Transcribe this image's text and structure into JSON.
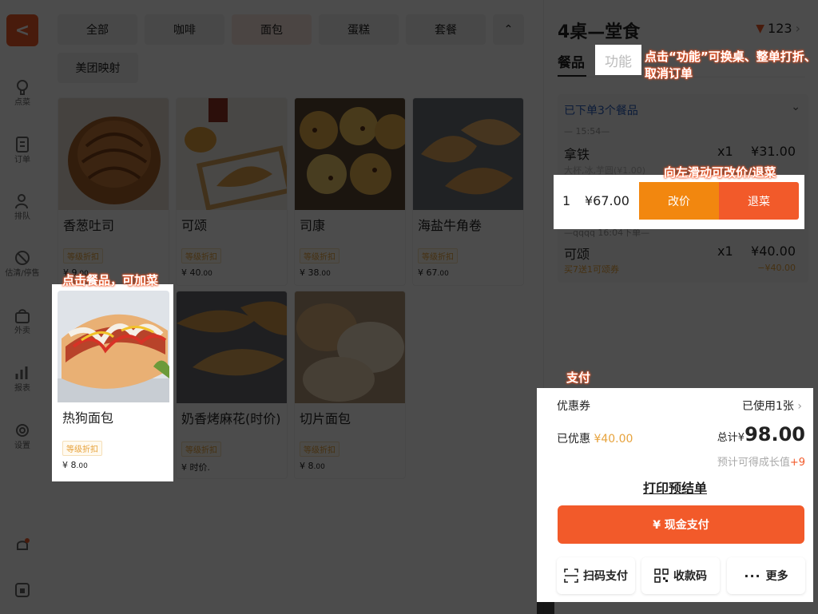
{
  "nav": {
    "back_label": "<",
    "items": [
      {
        "label": "点菜"
      },
      {
        "label": "订单"
      },
      {
        "label": "排队"
      },
      {
        "label": "估清/停售"
      },
      {
        "label": "外卖"
      },
      {
        "label": "报表"
      },
      {
        "label": "设置"
      }
    ]
  },
  "categories": [
    "全部",
    "咖啡",
    "面包",
    "蛋糕",
    "套餐",
    "美团映射"
  ],
  "active_category": "面包",
  "products": [
    {
      "name": "香葱吐司",
      "tag": "等级折扣",
      "currency": "¥",
      "price_int": "9",
      "price_dec": ".00"
    },
    {
      "name": "可颂",
      "tag": "等级折扣",
      "currency": "¥",
      "price_int": "40",
      "price_dec": ".00"
    },
    {
      "name": "司康",
      "tag": "等级折扣",
      "currency": "¥",
      "price_int": "38",
      "price_dec": ".00"
    },
    {
      "name": "海盐牛角卷",
      "tag": "等级折扣",
      "currency": "¥",
      "price_int": "67",
      "price_dec": ".00"
    },
    {
      "name": "热狗面包",
      "tag": "等级折扣",
      "currency": "¥",
      "price_int": "8",
      "price_dec": ".00"
    },
    {
      "name": "奶香烤麻花(时价)",
      "tag": "等级折扣",
      "currency": "¥",
      "price_int": "时价.",
      "price_dec": ""
    },
    {
      "name": "切片面包",
      "tag": "等级折扣",
      "currency": "¥",
      "price_int": "8",
      "price_dec": ".00"
    }
  ],
  "order": {
    "table_title": "4桌—堂食",
    "member_count": "123",
    "tab_items": "餐品",
    "tab_functions": "功能",
    "ordered_header": "已下单3个餐品",
    "batch1_time": "— 15:54—",
    "items": [
      {
        "name": "拿铁",
        "qty": "x1",
        "price": "¥31.00",
        "sub": "大杯,冰,芋圆(¥1.00)"
      },
      {
        "name": "可颂",
        "qty": "x1",
        "price": "¥40.00",
        "sub": "买7送1可颂券",
        "discount": "−¥40.00"
      }
    ],
    "swipe_row": {
      "qty": "1",
      "price": "¥67.00",
      "edit_price": "改价",
      "return_item": "退菜"
    },
    "batch2_label": "—qqqq 16:04下单—"
  },
  "payment": {
    "coupon_label": "优惠券",
    "coupon_used": "已使用1张",
    "discount_label": "已优惠",
    "discount_value": "¥40.00",
    "total_label": "总计",
    "total_currency": "¥",
    "total_value": "98.00",
    "growth_label": "预计可得成长值",
    "growth_value": "+9",
    "print_label": "打印预结单",
    "cash_label": "¥ 现金支付",
    "scan_label": "扫码支付",
    "qr_label": "收款码",
    "more_label": "更多"
  },
  "annotations": {
    "add_item": "点击餐品，可加菜",
    "functions_hint_line1": "点击“功能”可换桌、整单打折、",
    "functions_hint_line2": "取消订单",
    "swipe_hint": "向左滑动可改价/退菜",
    "pay_hint": "支付"
  },
  "colors": {
    "accent": "#f25a2a",
    "orange": "#f2870f",
    "link": "#2b5fbf",
    "tag": "#e7a33d"
  }
}
